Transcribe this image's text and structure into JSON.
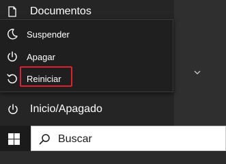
{
  "start_menu": {
    "documents_label": "Documentos",
    "power_label": "Inicio/Apagado"
  },
  "power_menu": {
    "items": [
      {
        "label": "Suspender",
        "icon": "moon-icon"
      },
      {
        "label": "Apagar",
        "icon": "power-icon"
      },
      {
        "label": "Reiniciar",
        "icon": "restart-icon"
      }
    ],
    "highlighted_item": "Reiniciar",
    "highlight_color": "#e0202a"
  },
  "taskbar": {
    "search_label": "Buscar",
    "start_icon": "windows-logo-icon",
    "search_icon": "search-icon"
  }
}
